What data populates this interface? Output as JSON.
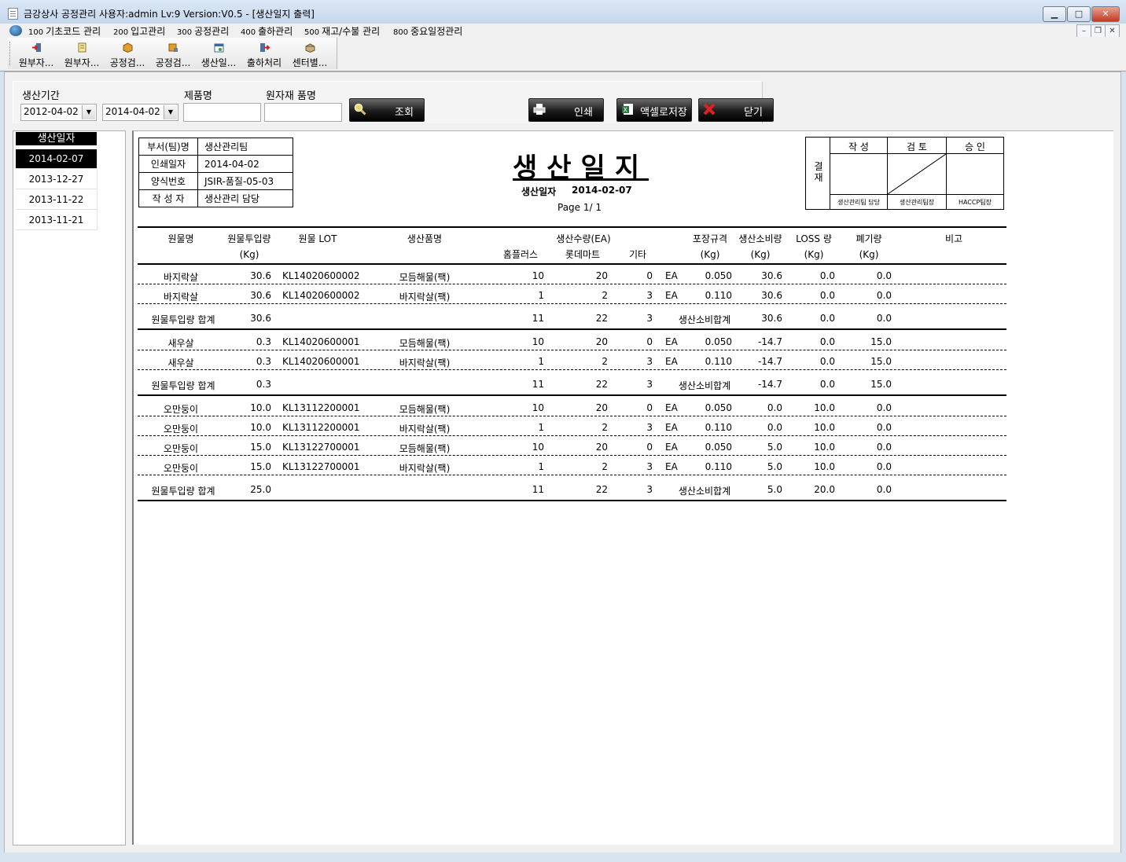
{
  "window": {
    "title": "금강상사 공정관리 사용자:admin Lv:9  Version:V0.5 - [생산일지 출력]",
    "min": "▁",
    "max": "□",
    "close": "✕"
  },
  "menu": [
    {
      "code": "100",
      "label": "기초코드 관리"
    },
    {
      "code": "200",
      "label": "입고관리"
    },
    {
      "code": "300",
      "label": "공정관리"
    },
    {
      "code": "400",
      "label": "출하관리"
    },
    {
      "code": "500",
      "label": "재고/수불 관리"
    },
    {
      "code": "800",
      "label": "중요일정관리"
    }
  ],
  "mdi": {
    "min": "–",
    "restore": "❐",
    "close": "✕"
  },
  "toolbar": [
    {
      "label": "원부자...",
      "icon": "import-icon"
    },
    {
      "label": "원부자...",
      "icon": "document-icon"
    },
    {
      "label": "공정검...",
      "icon": "box-icon"
    },
    {
      "label": "공정검...",
      "icon": "box-grid-icon"
    },
    {
      "label": "생산일...",
      "icon": "calendar-icon"
    },
    {
      "label": "출하처리",
      "icon": "export-icon"
    },
    {
      "label": "센터별...",
      "icon": "package-icon"
    }
  ],
  "filter": {
    "period_label": "생산기간",
    "date_from": "2012-04-02",
    "date_to": "2014-04-02",
    "product_label": "제품명",
    "material_label": "원자재 품명",
    "product_value": "",
    "material_value": "",
    "search_btn": "조회",
    "print_btn": "인쇄",
    "excel_btn": "액셀로저장",
    "close_btn": "닫기"
  },
  "date_list": {
    "header": "생산일자",
    "items": [
      "2014-02-07",
      "2013-12-27",
      "2013-11-22",
      "2013-11-21"
    ],
    "selected_index": 0
  },
  "report": {
    "info": [
      {
        "key": "부서(팀)명",
        "value": "생산관리팀"
      },
      {
        "key": "인쇄일자",
        "value": "2014-04-02"
      },
      {
        "key": "양식번호",
        "value": "JSIR-품질-05-03"
      },
      {
        "key": "작 성 자",
        "value": "생산관리 담당"
      }
    ],
    "title": "생산일지",
    "date_label": "생산일자",
    "date_value": "2014-02-07",
    "page": "Page 1/ 1",
    "approval": {
      "side": "결 재",
      "cols": [
        "작 성",
        "검 토",
        "승 인"
      ],
      "signers": [
        "생산관리팀 담당",
        "생산관리팀장",
        "HACCP팀장"
      ]
    },
    "headers": {
      "material": "원물명",
      "input": "원물투입량",
      "input_unit": "(Kg)",
      "lot": "원물 LOT",
      "product": "생산품명",
      "qty": "생산수량(EA)",
      "home": "홈플러스",
      "lotte": "롯데마트",
      "etc": "기타",
      "pack": "포장규격",
      "pack_unit": "(Kg)",
      "consume": "생산소비량",
      "consume_unit": "(Kg)",
      "loss": "LOSS 량",
      "loss_unit": "(Kg)",
      "waste": "폐기량",
      "waste_unit": "(Kg)",
      "note": "비고"
    },
    "groups": [
      {
        "rows": [
          {
            "material": "바지락살",
            "input": "30.6",
            "lot": "KL14020600002",
            "product": "모듬해물(팩)",
            "home": "10",
            "lotte": "20",
            "etc": "0",
            "unit": "EA",
            "pack": "0.050",
            "consume": "30.6",
            "loss": "0.0",
            "waste": "0.0"
          },
          {
            "material": "바지락살",
            "input": "30.6",
            "lot": "KL14020600002",
            "product": "바지락살(팩)",
            "home": "1",
            "lotte": "2",
            "etc": "3",
            "unit": "EA",
            "pack": "0.110",
            "consume": "30.6",
            "loss": "0.0",
            "waste": "0.0"
          }
        ],
        "total": {
          "label": "원물투입량 합계",
          "input": "30.6",
          "home": "11",
          "lotte": "22",
          "etc": "3",
          "consume_label": "생산소비합계",
          "consume": "30.6",
          "loss": "0.0",
          "waste": "0.0"
        }
      },
      {
        "rows": [
          {
            "material": "새우살",
            "input": "0.3",
            "lot": "KL14020600001",
            "product": "모듬해물(팩)",
            "home": "10",
            "lotte": "20",
            "etc": "0",
            "unit": "EA",
            "pack": "0.050",
            "consume": "-14.7",
            "loss": "0.0",
            "waste": "15.0"
          },
          {
            "material": "새우살",
            "input": "0.3",
            "lot": "KL14020600001",
            "product": "바지락살(팩)",
            "home": "1",
            "lotte": "2",
            "etc": "3",
            "unit": "EA",
            "pack": "0.110",
            "consume": "-14.7",
            "loss": "0.0",
            "waste": "15.0"
          }
        ],
        "total": {
          "label": "원물투입량 합계",
          "input": "0.3",
          "home": "11",
          "lotte": "22",
          "etc": "3",
          "consume_label": "생산소비합계",
          "consume": "-14.7",
          "loss": "0.0",
          "waste": "15.0"
        }
      },
      {
        "rows": [
          {
            "material": "오만둥이",
            "input": "10.0",
            "lot": "KL13112200001",
            "product": "모듬해물(팩)",
            "home": "10",
            "lotte": "20",
            "etc": "0",
            "unit": "EA",
            "pack": "0.050",
            "consume": "0.0",
            "loss": "10.0",
            "waste": "0.0"
          },
          {
            "material": "오만둥이",
            "input": "10.0",
            "lot": "KL13112200001",
            "product": "바지락살(팩)",
            "home": "1",
            "lotte": "2",
            "etc": "3",
            "unit": "EA",
            "pack": "0.110",
            "consume": "0.0",
            "loss": "10.0",
            "waste": "0.0"
          },
          {
            "material": "오만둥이",
            "input": "15.0",
            "lot": "KL13122700001",
            "product": "모듬해물(팩)",
            "home": "10",
            "lotte": "20",
            "etc": "0",
            "unit": "EA",
            "pack": "0.050",
            "consume": "5.0",
            "loss": "10.0",
            "waste": "0.0"
          },
          {
            "material": "오만둥이",
            "input": "15.0",
            "lot": "KL13122700001",
            "product": "바지락살(팩)",
            "home": "1",
            "lotte": "2",
            "etc": "3",
            "unit": "EA",
            "pack": "0.110",
            "consume": "5.0",
            "loss": "10.0",
            "waste": "0.0"
          }
        ],
        "total": {
          "label": "원물투입량 합계",
          "input": "25.0",
          "home": "11",
          "lotte": "22",
          "etc": "3",
          "consume_label": "생산소비합계",
          "consume": "5.0",
          "loss": "20.0",
          "waste": "0.0"
        }
      }
    ]
  }
}
